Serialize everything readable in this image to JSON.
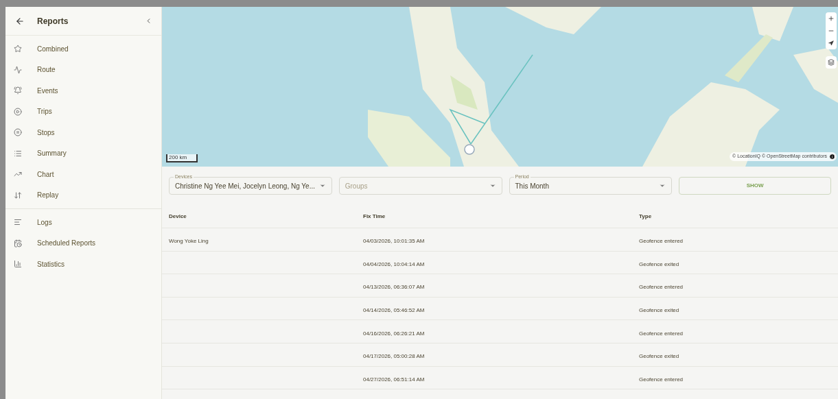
{
  "sidebar": {
    "title": "Reports",
    "groups": [
      [
        {
          "label": "Combined",
          "selected": false
        },
        {
          "label": "Route",
          "selected": false
        },
        {
          "label": "Events",
          "selected": false
        },
        {
          "label": "Trips",
          "selected": false
        },
        {
          "label": "Stops",
          "selected": false
        },
        {
          "label": "Summary",
          "selected": false
        },
        {
          "label": "Chart",
          "selected": false
        },
        {
          "label": "Replay",
          "selected": false
        }
      ],
      [
        {
          "label": "Logs",
          "selected": false
        },
        {
          "label": "Scheduled Reports",
          "selected": false
        },
        {
          "label": "Statistics",
          "selected": false
        }
      ]
    ]
  },
  "map": {
    "scale": "200 km",
    "attribution": "© LocationIQ © OpenStreetMap contributors"
  },
  "filters": [
    {
      "label": "Devices",
      "value": "Christine Ng Yee Mei, Jocelyn Leong, Ng Ye..."
    },
    {
      "placeholder": "Groups"
    },
    {
      "label": "Period",
      "value": "This Month"
    }
  ],
  "show_button": "SHOW",
  "table": {
    "columns": [
      "Device",
      "Fix Time",
      "Type"
    ],
    "rows": [
      [
        "Wong Yoke Ling",
        "04/03/2026, 10:01:35 AM",
        "Geofence entered"
      ],
      [
        "",
        "04/04/2026, 10:04:14 AM",
        "Geofence exited"
      ],
      [
        "",
        "04/13/2026, 06:36:07 AM",
        "Geofence entered"
      ],
      [
        "",
        "04/14/2026, 05:46:52 AM",
        "Geofence exited"
      ],
      [
        "",
        "04/16/2026, 06:26:21 AM",
        "Geofence entered"
      ],
      [
        "",
        "04/17/2026, 05:00:28 AM",
        "Geofence exited"
      ],
      [
        "",
        "04/27/2026, 06:51:14 AM",
        "Geofence entered"
      ]
    ]
  }
}
